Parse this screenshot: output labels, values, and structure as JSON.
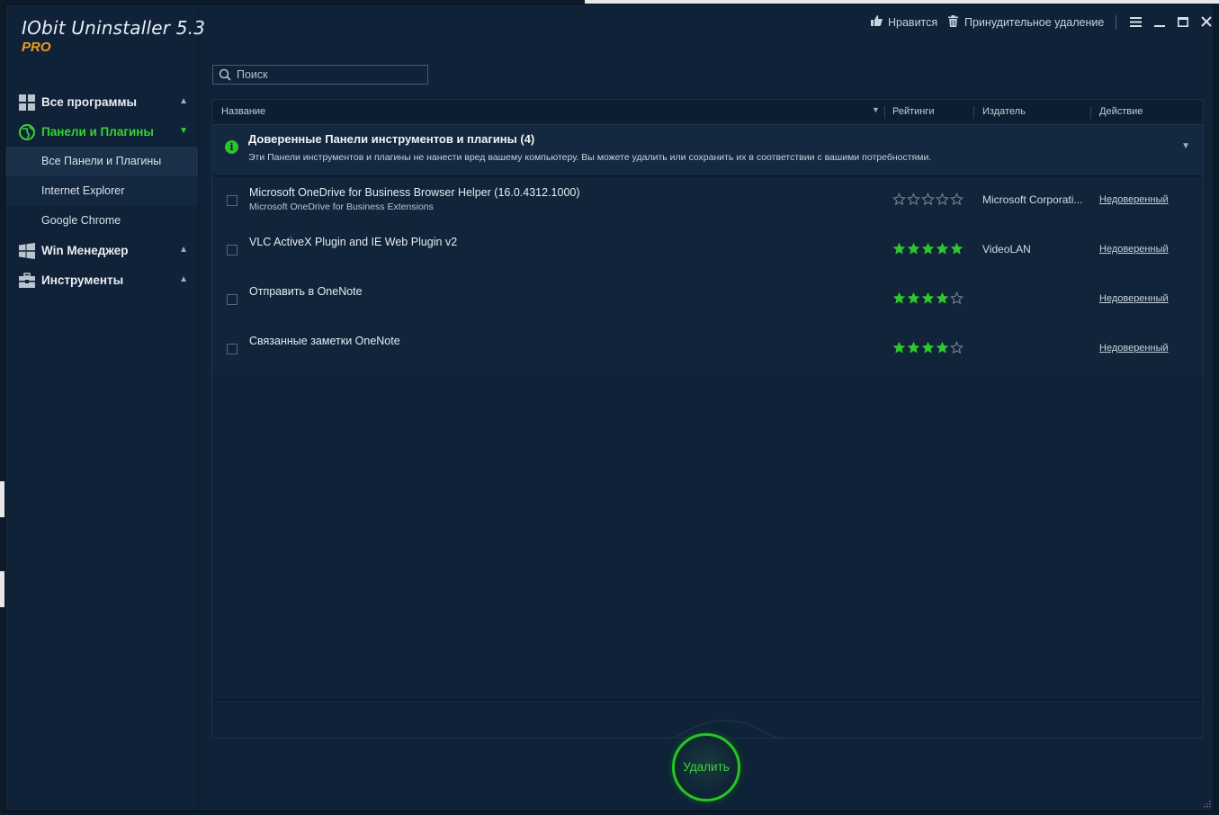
{
  "app": {
    "title": "IObit Uninstaller 5.3",
    "edition": "PRO"
  },
  "topbar": {
    "like_label": "Нравится",
    "force_uninstall_label": "Принудительное удаление"
  },
  "sidebar": {
    "items": [
      {
        "label": "Все программы",
        "icon": "grid-icon",
        "expanded": false
      },
      {
        "label": "Панели и Плагины",
        "icon": "globe-icon",
        "expanded": true
      },
      {
        "label": "Win Менеджер",
        "icon": "windows-icon",
        "expanded": false
      },
      {
        "label": "Инструменты",
        "icon": "toolbox-icon",
        "expanded": false
      }
    ],
    "sub_items": [
      {
        "label": "Все Панели и Плагины",
        "selected": true
      },
      {
        "label": "Internet Explorer"
      },
      {
        "label": "Google Chrome"
      }
    ]
  },
  "search": {
    "placeholder": "Поиск",
    "value": ""
  },
  "table": {
    "columns": {
      "name": "Название",
      "ratings": "Рейтинги",
      "publisher": "Издатель",
      "action": "Действие"
    },
    "group": {
      "title": "Доверенные Панели инструментов и плагины (4)",
      "description": "Эти Панели инструментов и плагины не нанести вред вашему компьютеру. Вы можете удалить или сохранить их в соответствии с вашими потребностями."
    },
    "rows": [
      {
        "name": "Microsoft OneDrive for Business Browser Helper (16.0.4312.1000)",
        "subtitle": "Microsoft OneDrive for Business Extensions",
        "rating": 0,
        "publisher": "Microsoft Corporati...",
        "action": "Недоверенный"
      },
      {
        "name": "VLC ActiveX Plugin and IE Web Plugin v2",
        "subtitle": "",
        "rating": 5,
        "publisher": "VideoLAN",
        "action": "Недоверенный"
      },
      {
        "name": "Отправить в OneNote",
        "subtitle": "",
        "rating": 4,
        "publisher": "",
        "action": "Недоверенный"
      },
      {
        "name": "Связанные заметки OneNote",
        "subtitle": "",
        "rating": 4,
        "publisher": "",
        "action": "Недоверенный"
      }
    ]
  },
  "footer": {
    "uninstall_label": "Удалить"
  },
  "colors": {
    "accent_green": "#35d335",
    "logo_pro": "#f59a1b",
    "background": "#0f2238"
  }
}
